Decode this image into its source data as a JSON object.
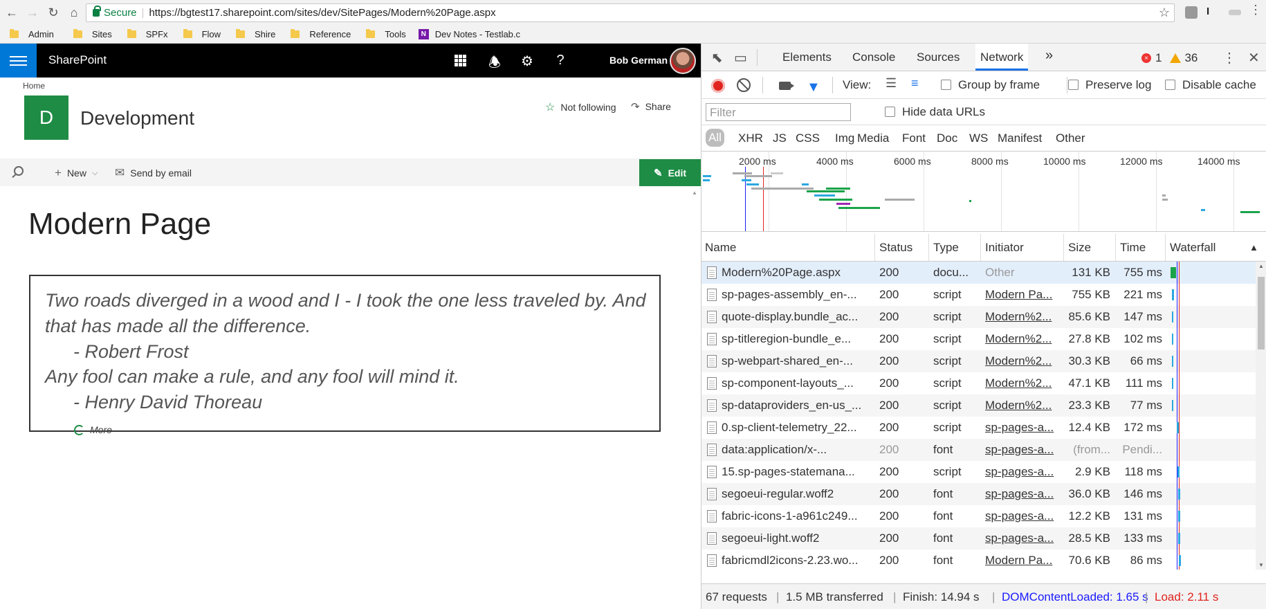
{
  "browser": {
    "secure_label": "Secure",
    "url": "https://bgtest17.sharepoint.com/sites/dev/SitePages/Modern%20Page.aspx",
    "bookmarks": [
      "Admin",
      "Sites",
      "SPFx",
      "Flow",
      "Shire",
      "Reference",
      "Tools",
      "Dev Notes - Testlab.c"
    ]
  },
  "sharepoint": {
    "brand": "SharePoint",
    "user_name": "Bob German",
    "breadcrumb": "Home",
    "site_initial": "D",
    "site_title": "Development",
    "follow_label": "Not following",
    "share_label": "Share",
    "commands": {
      "new_label": "New",
      "email_label": "Send by email",
      "edit_label": "Edit"
    },
    "page_title": "Modern Page",
    "quote_lines": [
      "Two roads diverged in a wood and I - I took the one less traveled by. And",
      "that has made all the difference.",
      "- Robert Frost",
      "Any fool can make a rule, and any fool will mind it.",
      "- Henry David Thoreau"
    ],
    "more_label": "More",
    "accent": "#1e8c45",
    "waffle_color": "#0078d7"
  },
  "devtools": {
    "tabs": [
      "Elements",
      "Console",
      "Sources",
      "Network"
    ],
    "active_tab": "Network",
    "error_count": "1",
    "warning_count": "36",
    "view_label": "View:",
    "group_by_frame": "Group by frame",
    "preserve_log": "Preserve log",
    "disable_cache": "Disable cache",
    "filter_placeholder": "Filter",
    "hide_data_urls": "Hide data URLs",
    "types": [
      "All",
      "XHR",
      "JS",
      "CSS",
      "Img",
      "Media",
      "Font",
      "Doc",
      "WS",
      "Manifest",
      "Other"
    ],
    "overview_ticks": [
      "2000 ms",
      "4000 ms",
      "6000 ms",
      "8000 ms",
      "10000 ms",
      "12000 ms",
      "14000 ms"
    ],
    "columns": [
      "Name",
      "Status",
      "Type",
      "Initiator",
      "Size",
      "Time",
      "Waterfall"
    ],
    "rows": [
      {
        "name": "Modern%20Page.aspx",
        "status": "200",
        "type": "docu...",
        "initiator": "Other",
        "size": "131 KB",
        "time": "755 ms"
      },
      {
        "name": "sp-pages-assembly_en-...",
        "status": "200",
        "type": "script",
        "initiator": "Modern Pa...",
        "size": "755 KB",
        "time": "221 ms"
      },
      {
        "name": "quote-display.bundle_ac...",
        "status": "200",
        "type": "script",
        "initiator": "Modern%2...",
        "size": "85.6 KB",
        "time": "147 ms"
      },
      {
        "name": "sp-titleregion-bundle_e...",
        "status": "200",
        "type": "script",
        "initiator": "Modern%2...",
        "size": "27.8 KB",
        "time": "102 ms"
      },
      {
        "name": "sp-webpart-shared_en-...",
        "status": "200",
        "type": "script",
        "initiator": "Modern%2...",
        "size": "30.3 KB",
        "time": "66 ms"
      },
      {
        "name": "sp-component-layouts_...",
        "status": "200",
        "type": "script",
        "initiator": "Modern%2...",
        "size": "47.1 KB",
        "time": "111 ms"
      },
      {
        "name": "sp-dataproviders_en-us_...",
        "status": "200",
        "type": "script",
        "initiator": "Modern%2...",
        "size": "23.3 KB",
        "time": "77 ms"
      },
      {
        "name": "0.sp-client-telemetry_22...",
        "status": "200",
        "type": "script",
        "initiator": "sp-pages-a...",
        "size": "12.4 KB",
        "time": "172 ms"
      },
      {
        "name": "data:application/x-...",
        "status": "200",
        "type": "font",
        "initiator": "sp-pages-a...",
        "size": "(from...",
        "time": "Pendi..."
      },
      {
        "name": "15.sp-pages-statemana...",
        "status": "200",
        "type": "script",
        "initiator": "sp-pages-a...",
        "size": "2.9 KB",
        "time": "118 ms"
      },
      {
        "name": "segoeui-regular.woff2",
        "status": "200",
        "type": "font",
        "initiator": "sp-pages-a...",
        "size": "36.0 KB",
        "time": "146 ms"
      },
      {
        "name": "fabric-icons-1-a961c249...",
        "status": "200",
        "type": "font",
        "initiator": "sp-pages-a...",
        "size": "12.2 KB",
        "time": "131 ms"
      },
      {
        "name": "segoeui-light.woff2",
        "status": "200",
        "type": "font",
        "initiator": "sp-pages-a...",
        "size": "28.5 KB",
        "time": "133 ms"
      },
      {
        "name": "fabricmdl2icons-2.23.wo...",
        "status": "200",
        "type": "font",
        "initiator": "Modern Pa...",
        "size": "70.6 KB",
        "time": "86 ms"
      }
    ],
    "status_bar": {
      "requests": "67 requests",
      "transferred": "1.5 MB transferred",
      "finish": "Finish: 14.94 s",
      "dom_loaded": "DOMContentLoaded: 1.65 s",
      "load": "Load: 2.11 s"
    },
    "dom_color": "#1a1aff",
    "load_color": "#e0231e"
  }
}
